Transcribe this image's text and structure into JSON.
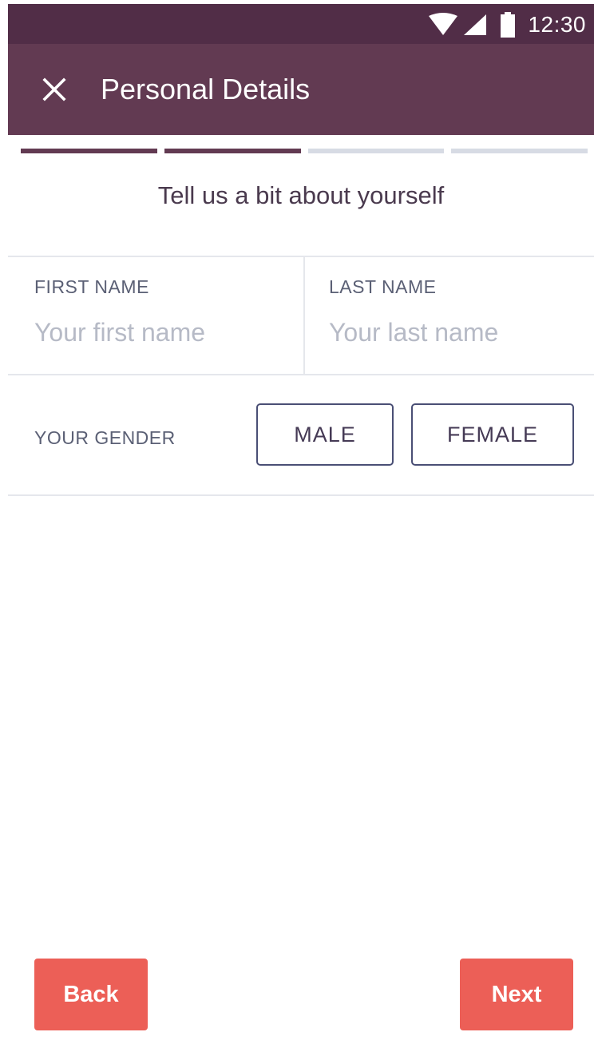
{
  "status_bar": {
    "time": "12:30",
    "icons": [
      "wifi-icon",
      "signal-icon",
      "battery-icon"
    ]
  },
  "app_bar": {
    "title": "Personal Details",
    "close_icon": "close-icon",
    "color": "#623a52"
  },
  "progress": {
    "total_steps": 4,
    "completed_steps": 2,
    "active_color": "#623a52",
    "inactive_color": "#d7dbe4"
  },
  "form": {
    "subtitle": "Tell us a bit about yourself",
    "first_name": {
      "label": "FIRST NAME",
      "placeholder": "Your first name",
      "value": ""
    },
    "last_name": {
      "label": "LAST NAME",
      "placeholder": "Your last name",
      "value": ""
    },
    "gender": {
      "label": "YOUR GENDER",
      "options": [
        "MALE",
        "FEMALE"
      ]
    }
  },
  "footer": {
    "back_label": "Back",
    "next_label": "Next",
    "button_color": "#ec5f57"
  }
}
